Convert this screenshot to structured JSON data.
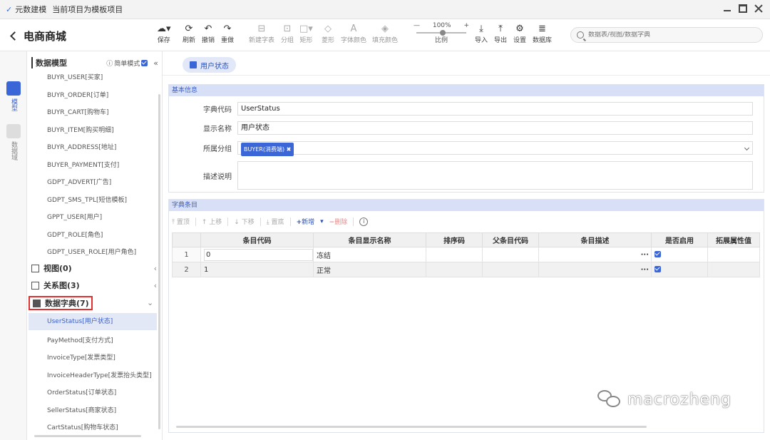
{
  "titlebar": {
    "app_name": "元数建模",
    "hint": "当前项目为模板项目"
  },
  "header": {
    "back_title": "电商商城"
  },
  "toolbar": {
    "save": "保存",
    "refresh": "刷新",
    "undo": "撤销",
    "redo": "重做",
    "new_table": "新建字表",
    "group": "分组",
    "rect": "矩形",
    "diamond": "菱形",
    "font_color": "字体颜色",
    "fill_color": "填充颜色",
    "zoom_value": "100%",
    "zoom_label": "比例",
    "import": "导入",
    "export": "导出",
    "settings": "设置",
    "database": "数据库"
  },
  "search": {
    "placeholder": "数据表/视图/数据字典"
  },
  "rail": [
    {
      "label": "模型",
      "icon": "cube-icon",
      "active": true
    },
    {
      "label": "数据域",
      "icon": "database-domain-icon",
      "active": false
    }
  ],
  "tree": {
    "title": "数据模型",
    "simple_mode": "简单模式",
    "tables": [
      "BUYR_USER[买家]",
      "BUYR_ORDER[订单]",
      "BUYR_CART[购物车]",
      "BUYR_ITEM[购买明细]",
      "BUYR_ADDRESS[地址]",
      "BUYER_PAYMENT[支付]",
      "GDPT_ADVERT[广告]",
      "GDPT_SMS_TPL[短信模板]",
      "GPPT_USER[用户]",
      "GDPT_ROLE[角色]",
      "GDPT_USER_ROLE[用户角色]"
    ],
    "views_group": "视图(0)",
    "relation_group": "关系图(3)",
    "dict_group": "数据字典(7)",
    "dicts": [
      "UserStatus[用户状态]",
      "PayMethod[支付方式]",
      "InvoiceType[发票类型]",
      "InvoiceHeaderType[发票抬头类型]",
      "OrderStatus[订单状态]",
      "SellerStatus[商家状态]",
      "CartStatus[购物车状态]"
    ]
  },
  "tab": {
    "label": "用户状态"
  },
  "basic": {
    "section": "基本信息",
    "code_label": "字典代码",
    "code_value": "UserStatus",
    "name_label": "显示名称",
    "name_value": "用户状态",
    "group_label": "所属分组",
    "group_tag": "BUYER(消费端) ✖",
    "desc_label": "描述说明",
    "desc_value": ""
  },
  "items": {
    "section": "字典条目",
    "toolbar": {
      "top": "置顶",
      "up": "上移",
      "down": "下移",
      "bottom": "置底",
      "add": "新增",
      "delete": "删除"
    },
    "columns": [
      "",
      "条目代码",
      "条目显示名称",
      "排序码",
      "父条目代码",
      "条目描述",
      "是否启用",
      "拓展属性值"
    ],
    "rows": [
      {
        "idx": "1",
        "code": "0",
        "name": "冻结",
        "sort": "",
        "parent": "",
        "desc": "",
        "enabled": true
      },
      {
        "idx": "2",
        "code": "1",
        "name": "正常",
        "sort": "",
        "parent": "",
        "desc": "",
        "enabled": true
      }
    ]
  },
  "watermark": "macrozheng",
  "colors": {
    "accent": "#3a66d8",
    "section_bg": "#d7e0f6",
    "highlight_border": "#e03030"
  }
}
